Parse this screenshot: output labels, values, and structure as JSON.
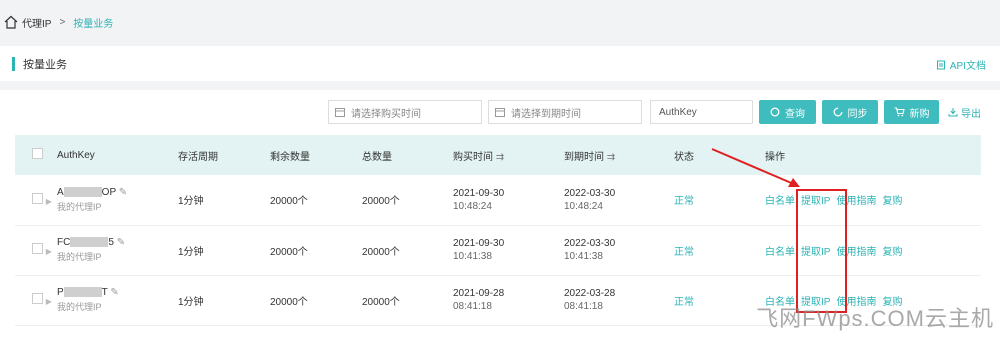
{
  "breadcrumb": {
    "root": "代理IP",
    "sep": ">",
    "current": "按量业务"
  },
  "header": {
    "title": "按量业务",
    "api_doc": "API文档"
  },
  "toolbar": {
    "buy_time_placeholder": "请选择购买时间",
    "expire_time_placeholder": "请选择到期时间",
    "authkey_placeholder": "AuthKey",
    "query": "查询",
    "sync": "同步",
    "new_buy": "新购",
    "export": "导出"
  },
  "table": {
    "headers": [
      "AuthKey",
      "存活周期",
      "剩余数量",
      "总数量",
      "购买时间",
      "到期时间",
      "状态",
      "操作"
    ],
    "rows": [
      {
        "key_prefix": "A",
        "key_suffix": "OP",
        "desc": "我的代理IP",
        "cycle": "1分钟",
        "remain": "20000个",
        "total": "20000个",
        "buy_date": "2021-09-30",
        "buy_time": "10:48:24",
        "exp_date": "2022-03-30",
        "exp_time": "10:48:24",
        "status": "正常"
      },
      {
        "key_prefix": "FC",
        "key_suffix": "5",
        "desc": "我的代理IP",
        "cycle": "1分钟",
        "remain": "20000个",
        "total": "20000个",
        "buy_date": "2021-09-30",
        "buy_time": "10:41:38",
        "exp_date": "2022-03-30",
        "exp_time": "10:41:38",
        "status": "正常"
      },
      {
        "key_prefix": "P",
        "key_suffix": "T",
        "desc": "我的代理IP",
        "cycle": "1分钟",
        "remain": "20000个",
        "total": "20000个",
        "buy_date": "2021-09-28",
        "buy_time": "08:41:18",
        "exp_date": "2022-03-28",
        "exp_time": "08:41:18",
        "status": "正常"
      }
    ],
    "ops": [
      "白名单",
      "提取IP",
      "使用指南",
      "复购"
    ]
  },
  "watermark": "飞网FWps.COM云主机",
  "colors": {
    "accent": "#2bb3b5",
    "highlight_box": "#e02020"
  }
}
